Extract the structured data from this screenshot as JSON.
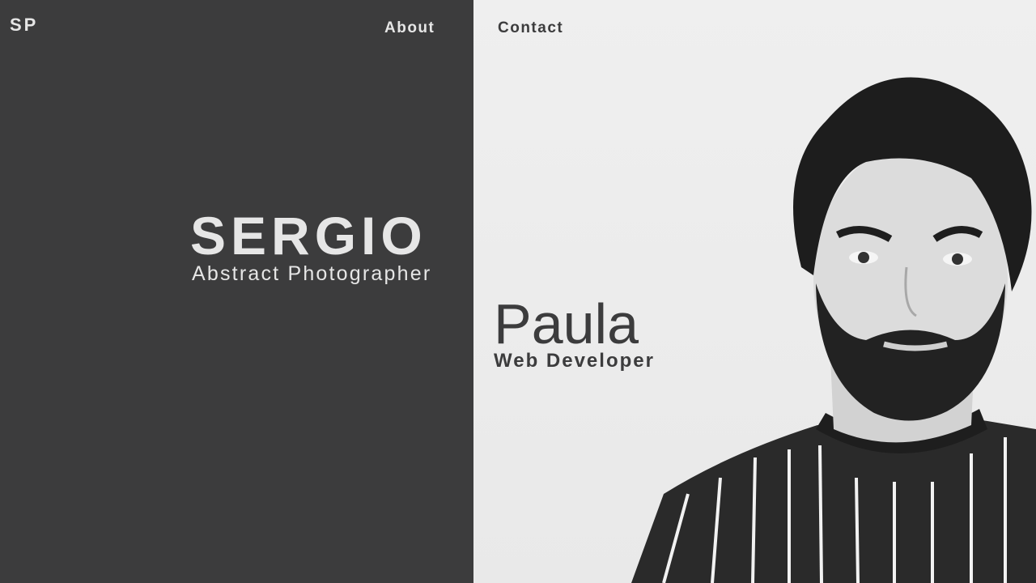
{
  "logo": "SP",
  "nav": {
    "about": "About",
    "contact": "Contact"
  },
  "left_panel": {
    "name": "SERGIO",
    "role": "Abstract Photographer",
    "background": "#3c3c3d"
  },
  "right_panel": {
    "name": "Paula",
    "role": "Web Developer",
    "background": "#ececec"
  }
}
